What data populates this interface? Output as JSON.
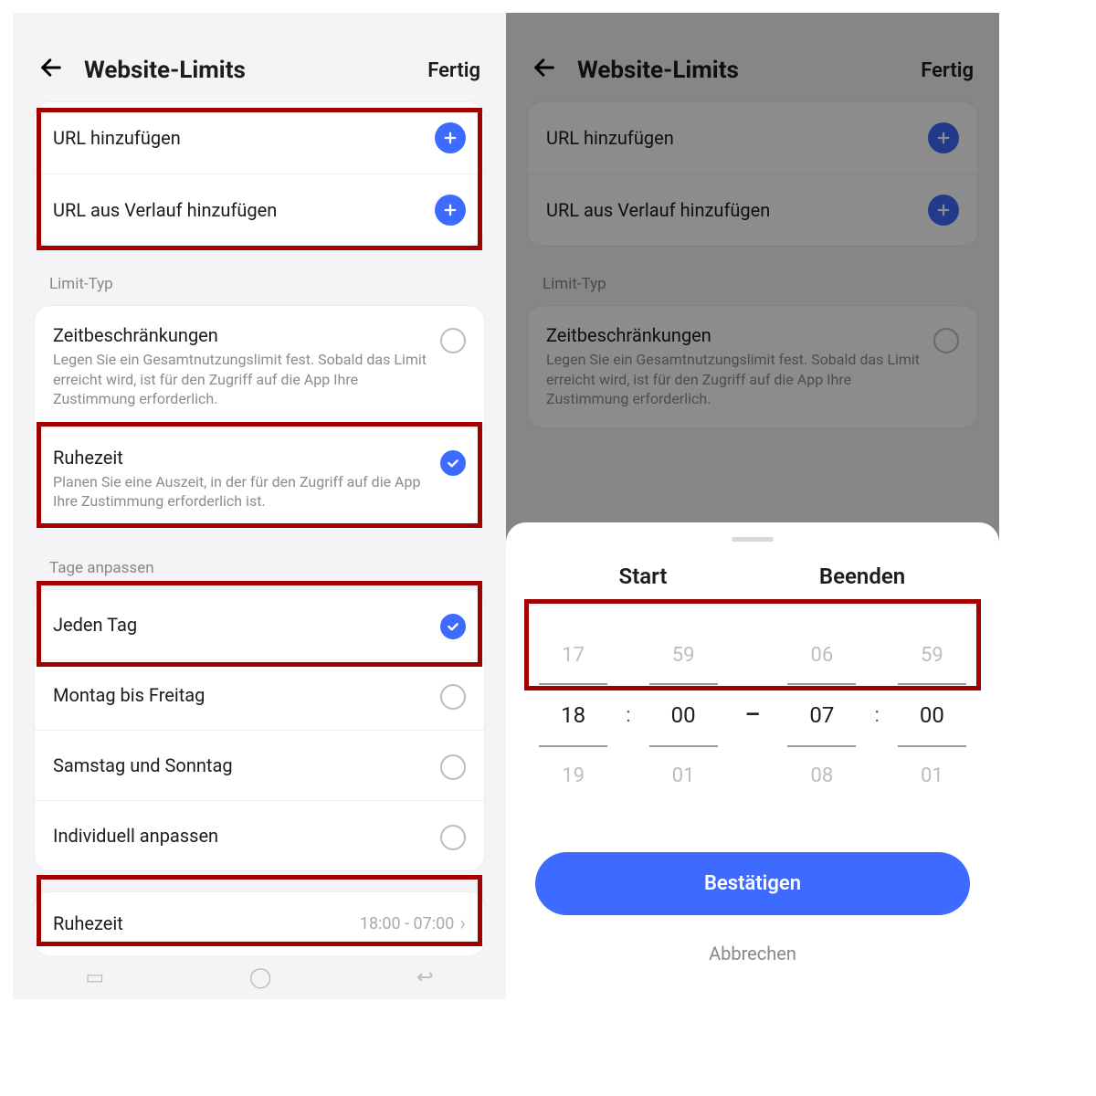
{
  "header": {
    "title": "Website-Limits",
    "done": "Fertig"
  },
  "add": {
    "url": "URL hinzufügen",
    "history": "URL aus Verlauf hinzufügen"
  },
  "limit_type": {
    "label": "Limit-Typ",
    "time": {
      "title": "Zeitbeschränkungen",
      "desc": "Legen Sie ein Gesamtnutzungslimit fest. Sobald das Limit erreicht wird, ist für den Zugriff auf die App Ihre Zustimmung erforderlich."
    },
    "rest": {
      "title": "Ruhezeit",
      "desc": "Planen Sie eine Auszeit, in der für den Zugriff auf die App Ihre Zustimmung erforderlich ist."
    }
  },
  "days": {
    "label": "Tage anpassen",
    "every": "Jeden Tag",
    "weekdays": "Montag bis Freitag",
    "weekend": "Samstag und Sonntag",
    "custom": "Individuell anpassen"
  },
  "downtime": {
    "label": "Ruhezeit",
    "value": "18:00 - 07:00"
  },
  "sheet": {
    "start": "Start",
    "end": "Beenden",
    "confirm": "Bestätigen",
    "cancel": "Abbrechen",
    "picker": {
      "start_h_prev": "17",
      "start_h": "18",
      "start_h_next": "19",
      "start_m_prev": "59",
      "start_m": "00",
      "start_m_next": "01",
      "end_h_prev": "06",
      "end_h": "07",
      "end_h_next": "08",
      "end_m_prev": "59",
      "end_m": "00",
      "end_m_next": "01"
    }
  }
}
